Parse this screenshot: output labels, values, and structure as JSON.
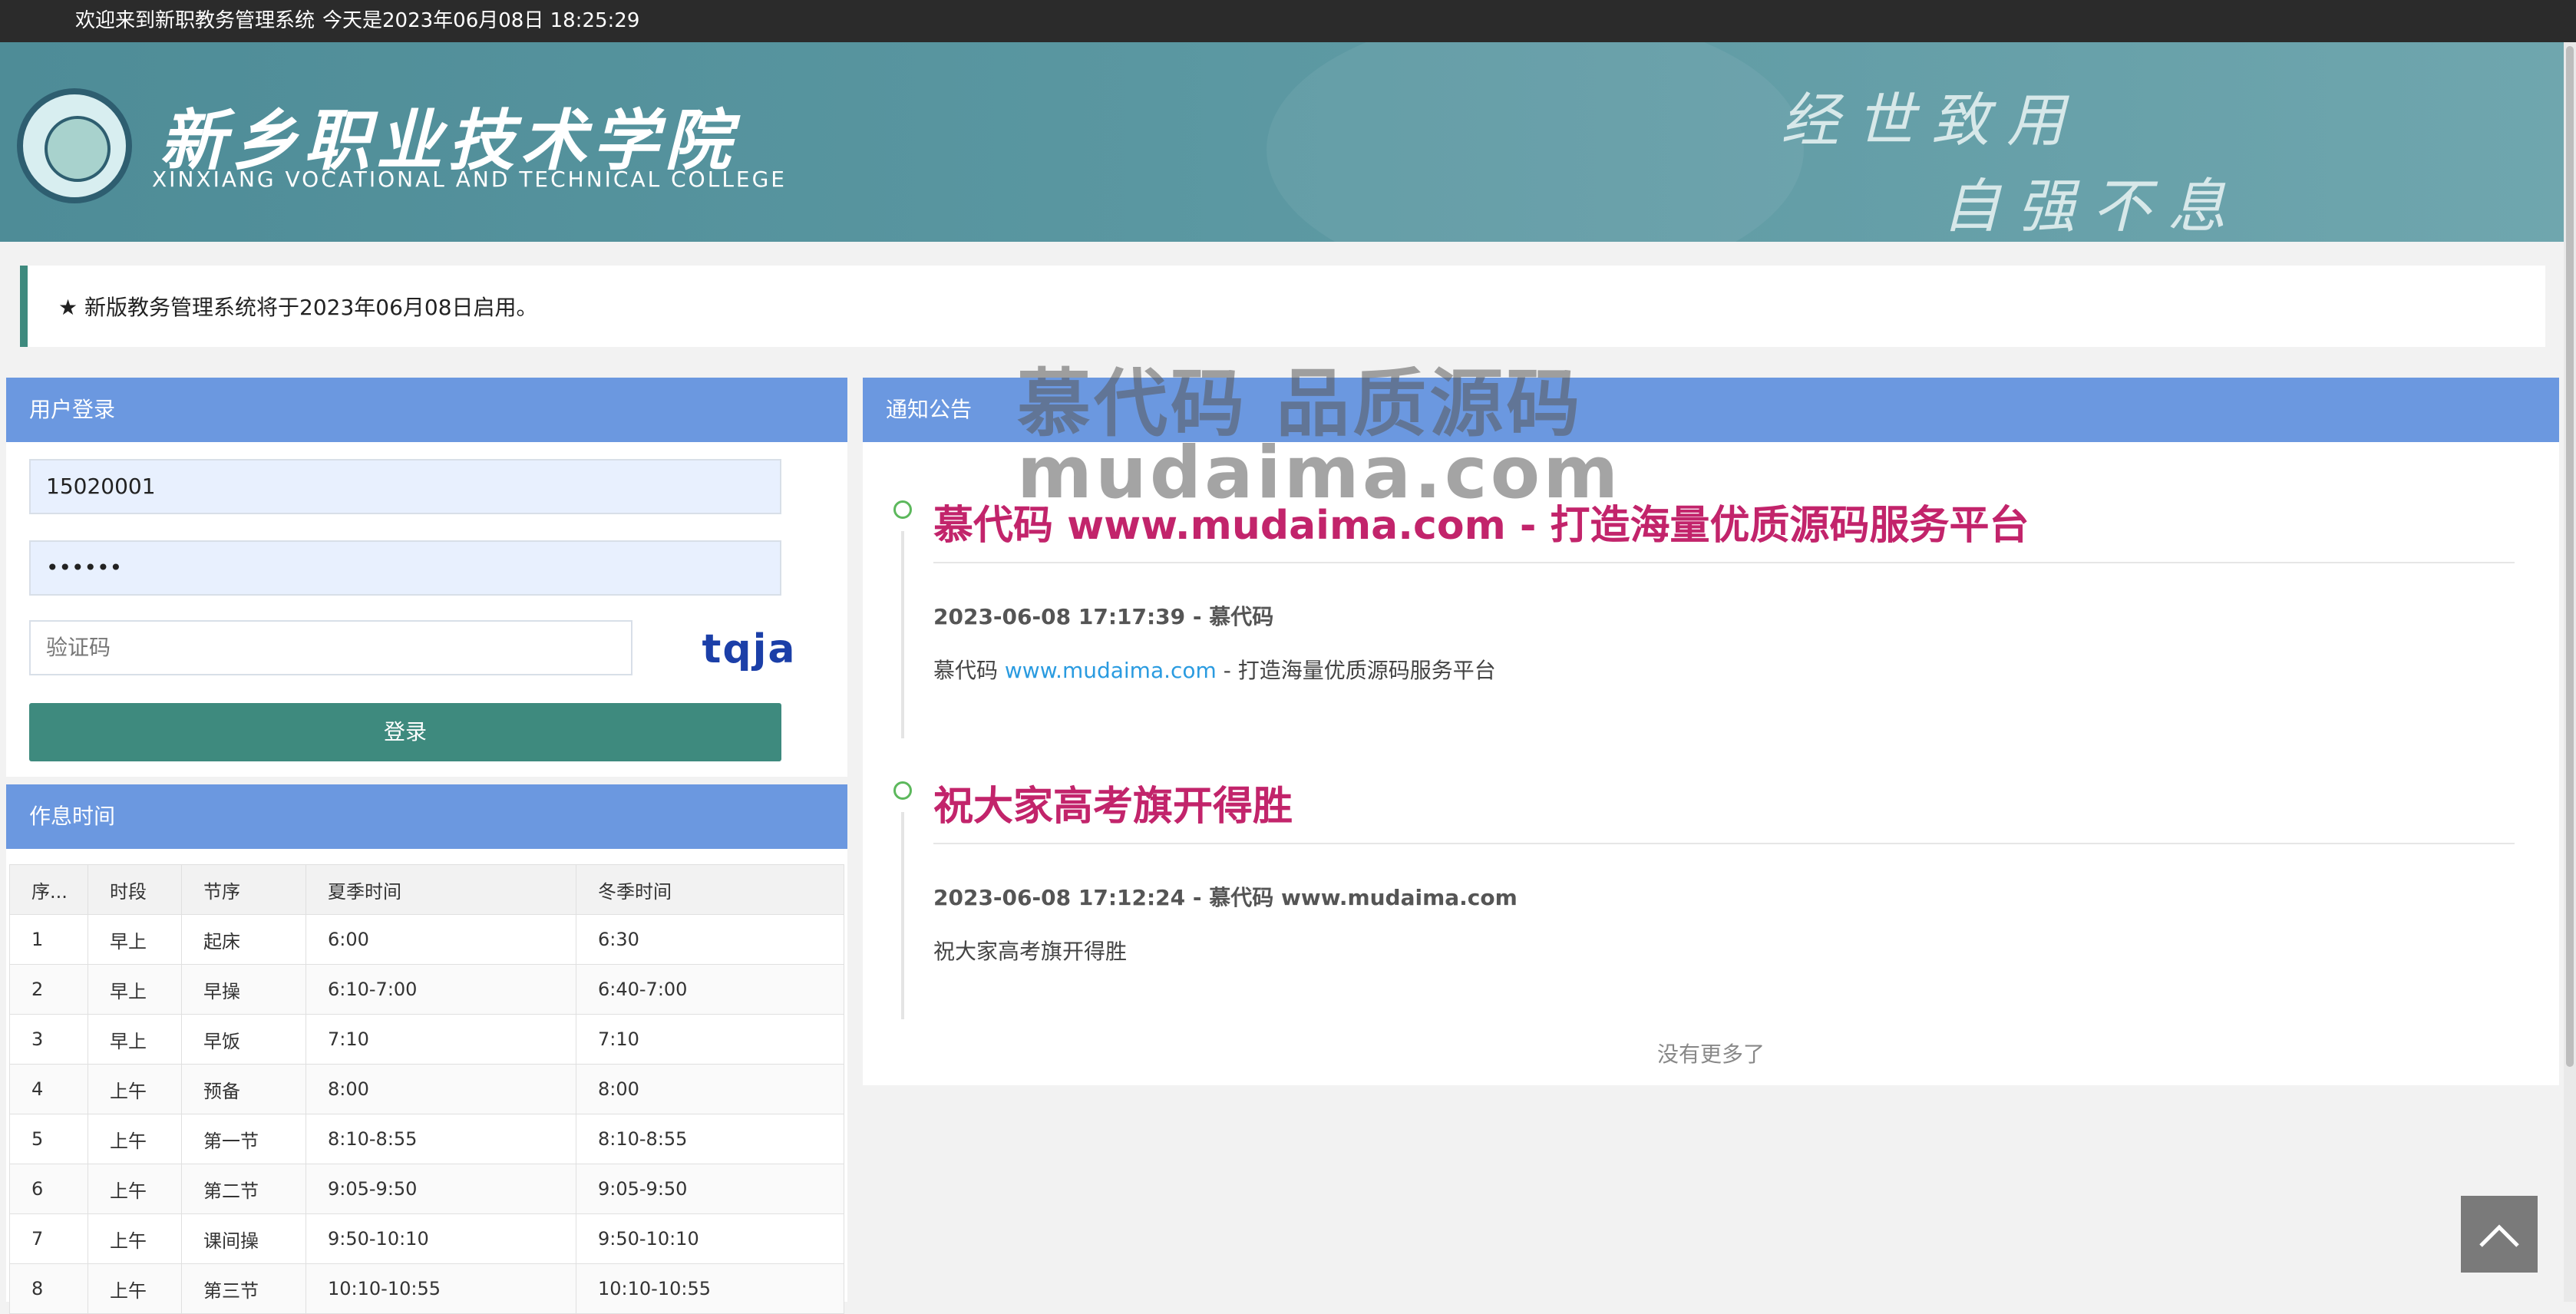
{
  "topbar": {
    "welcome": "欢迎来到新职教务管理系统",
    "today": "今天是2023年06月08日 18:25:29"
  },
  "header": {
    "college_cn": "新乡职业技术学院",
    "college_en": "XINXIANG VOCATIONAL AND TECHNICAL COLLEGE",
    "motto_line1": "经世致用",
    "motto_line2": "自强不息"
  },
  "notice": {
    "text": "★ 新版教务管理系统将于2023年06月08日启用。"
  },
  "login": {
    "title": "用户登录",
    "username": "15020001",
    "password_mask": "••••••",
    "captcha_placeholder": "验证码",
    "captcha_code": "tqja",
    "submit_label": "登录"
  },
  "schedule": {
    "title": "作息时间",
    "headers": [
      "序...",
      "时段",
      "节序",
      "夏季时间",
      "冬季时间"
    ],
    "rows": [
      [
        "1",
        "早上",
        "起床",
        "6:00",
        "6:30"
      ],
      [
        "2",
        "早上",
        "早操",
        "6:10-7:00",
        "6:40-7:00"
      ],
      [
        "3",
        "早上",
        "早饭",
        "7:10",
        "7:10"
      ],
      [
        "4",
        "上午",
        "预备",
        "8:00",
        "8:00"
      ],
      [
        "5",
        "上午",
        "第一节",
        "8:10-8:55",
        "8:10-8:55"
      ],
      [
        "6",
        "上午",
        "第二节",
        "9:05-9:50",
        "9:05-9:50"
      ],
      [
        "7",
        "上午",
        "课间操",
        "9:50-10:10",
        "9:50-10:10"
      ],
      [
        "8",
        "上午",
        "第三节",
        "10:10-10:55",
        "10:10-10:55"
      ]
    ]
  },
  "news": {
    "title": "通知公告",
    "items": [
      {
        "title": "慕代码 www.mudaima.com - 打造海量优质源码服务平台",
        "meta": "2023-06-08 17:17:39 - 慕代码",
        "body_prefix": "慕代码 ",
        "body_link": "www.mudaima.com",
        "body_suffix": " - 打造海量优质源码服务平台"
      },
      {
        "title": "祝大家高考旗开得胜",
        "meta": "2023-06-08 17:12:24 - 慕代码 www.mudaima.com",
        "body_prefix": "祝大家高考旗开得胜",
        "body_link": "",
        "body_suffix": ""
      }
    ],
    "no_more": "没有更多了"
  },
  "watermark": {
    "line1": "慕代码 品质源码",
    "line2": "mudaima.com"
  }
}
